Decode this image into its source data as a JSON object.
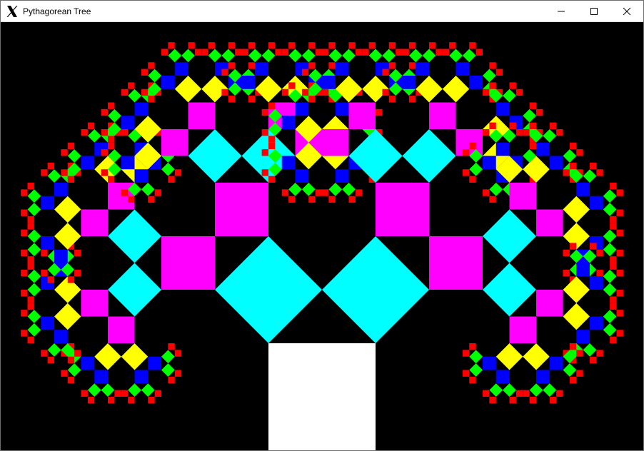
{
  "window": {
    "title": "Pythagorean Tree"
  },
  "controls": {
    "minimize_icon": "minimize-icon",
    "maximize_icon": "maximize-icon",
    "close_icon": "close-icon"
  },
  "fractal": {
    "depth": 9,
    "background": "#000000",
    "level_colors": [
      "#ffffff",
      "#00ffff",
      "#ff00ff",
      "#00ffff",
      "#ff00ff",
      "#ffff00",
      "#0000ff",
      "#00ff00",
      "#ff0000"
    ]
  }
}
